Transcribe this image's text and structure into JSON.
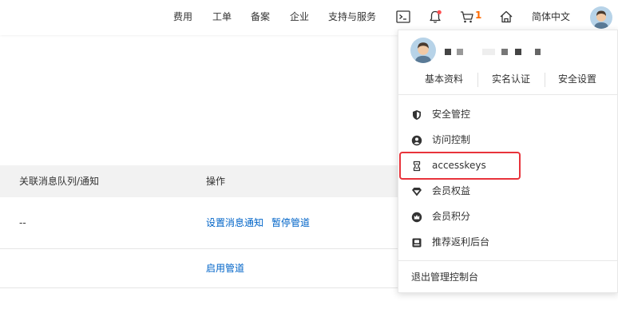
{
  "topnav": {
    "items": [
      {
        "label": "费用"
      },
      {
        "label": "工单"
      },
      {
        "label": "备案"
      },
      {
        "label": "企业"
      },
      {
        "label": "支持与服务"
      }
    ],
    "cart_count": "1",
    "language": "简体中文",
    "icons": [
      "terminal-icon",
      "bell-icon",
      "cart-icon",
      "home-icon"
    ],
    "notification_dot_color": "#ff4d4f",
    "accent_color": "#ff6a00"
  },
  "table": {
    "headers": [
      "关联消息队列/通知",
      "操作"
    ],
    "rows": [
      {
        "queue": "--",
        "actions": [
          "设置消息通知",
          "暂停管道"
        ]
      },
      {
        "queue": "",
        "actions": [
          "启用管道"
        ]
      }
    ],
    "link_color": "#0064c8"
  },
  "dropdown": {
    "quick_links": [
      "基本资料",
      "实名认证",
      "安全设置"
    ],
    "menu": [
      {
        "label": "安全管控",
        "icon": "shield-icon"
      },
      {
        "label": "访问控制",
        "icon": "user-circle-icon"
      },
      {
        "label": "accesskeys",
        "icon": "key-icon"
      },
      {
        "label": "会员权益",
        "icon": "diamond-icon"
      },
      {
        "label": "会员积分",
        "icon": "crown-icon"
      },
      {
        "label": "推荐返利后台",
        "icon": "ticket-icon"
      }
    ],
    "logout": "退出管理控制台",
    "highlight_color": "#e8333b"
  }
}
